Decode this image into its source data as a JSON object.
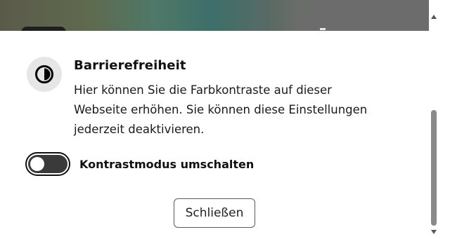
{
  "background": {
    "accent_colors": [
      "#5b5a4a",
      "#4f7868",
      "#6c6c6c"
    ]
  },
  "dialog": {
    "title": "Barrierefreiheit",
    "description": "Hier können Sie die Farbkontraste auf dieser Webseite erhöhen. Sie können diese Einstellungen jederzeit deaktivieren.",
    "icon": "contrast-icon",
    "toggle": {
      "label": "Kontrastmodus umschalten",
      "state": "off"
    },
    "close_label": "Schließen"
  },
  "colors": {
    "text": "#111111",
    "icon_bg": "#e6e6e6",
    "toggle_track": "#3a3a3a",
    "scrollbar_thumb": "#8a8a8a"
  }
}
